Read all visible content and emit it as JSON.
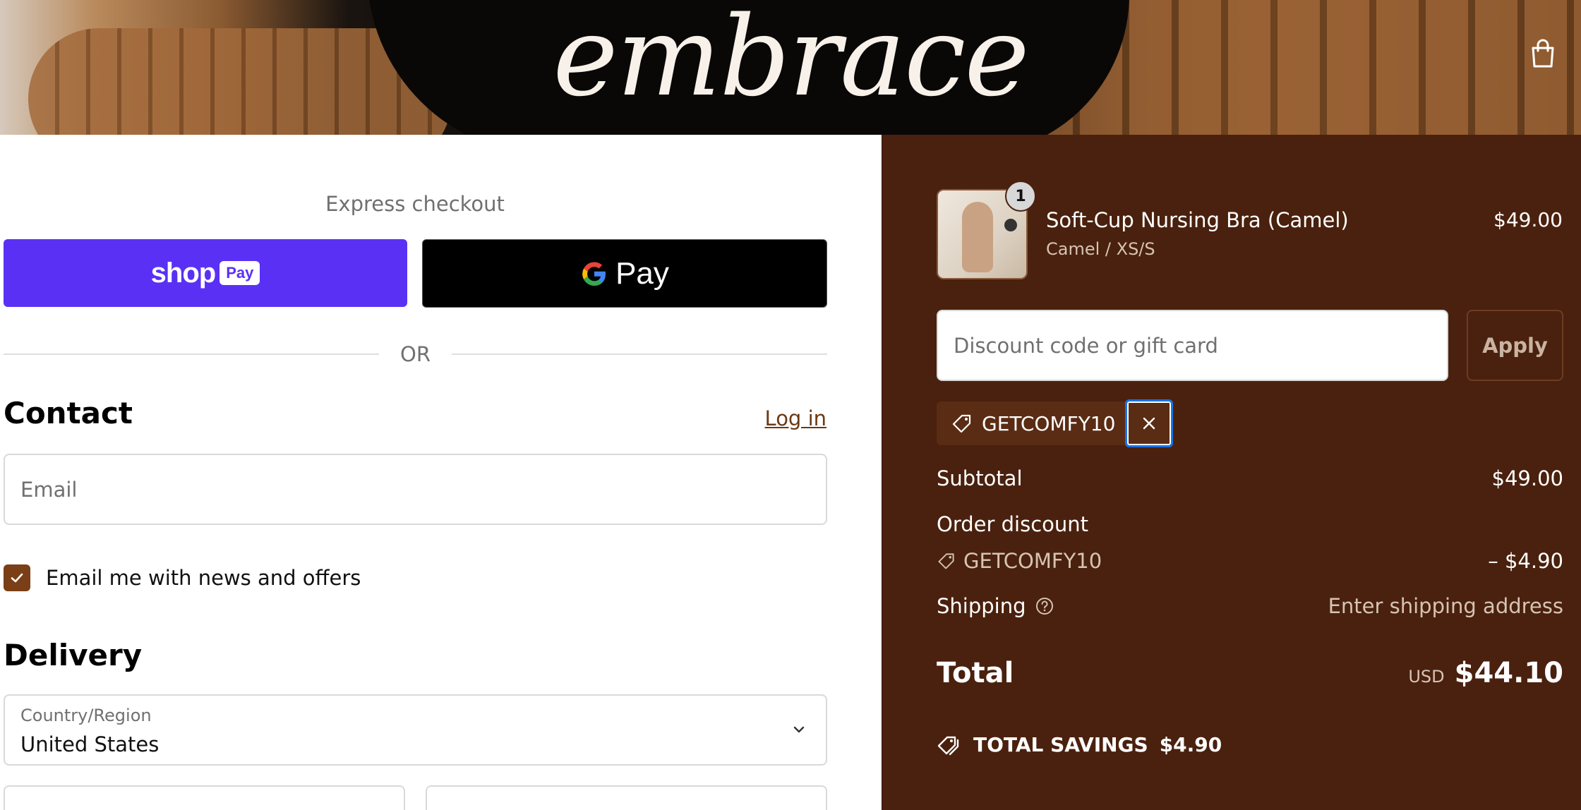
{
  "brand": {
    "logo_text": "embrace",
    "accent": "#4a210e"
  },
  "header": {
    "cart_icon": "shopping-bag-icon"
  },
  "express": {
    "title": "Express checkout",
    "shop_pay": {
      "word": "shop",
      "badge": "Pay",
      "color": "#5a31f4"
    },
    "google_pay": {
      "word": "Pay"
    },
    "divider_text": "OR"
  },
  "contact": {
    "title": "Contact",
    "login_link": "Log in",
    "email_placeholder": "Email",
    "newsletter_label": "Email me with news and offers",
    "newsletter_checked": true
  },
  "delivery": {
    "title": "Delivery",
    "country_label": "Country/Region",
    "country_value": "United States"
  },
  "summary": {
    "item": {
      "title": "Soft-Cup Nursing Bra (Camel)",
      "variant": "Camel / XS/S",
      "price": "$49.00",
      "quantity": "1"
    },
    "discount_placeholder": "Discount code or gift card",
    "apply_label": "Apply",
    "applied_code": "GETCOMFY10",
    "subtotal_label": "Subtotal",
    "subtotal_value": "$49.00",
    "order_discount_label": "Order discount",
    "discount_code": "GETCOMFY10",
    "discount_value": "– $4.90",
    "shipping_label": "Shipping",
    "shipping_value": "Enter shipping address",
    "total_label": "Total",
    "currency": "USD",
    "total_value": "$44.10",
    "savings_label": "TOTAL SAVINGS",
    "savings_value": "$4.90"
  }
}
